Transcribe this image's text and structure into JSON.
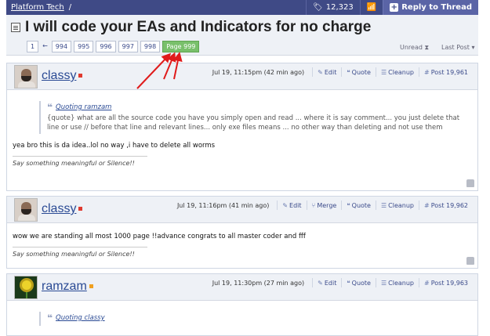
{
  "topbar": {
    "breadcrumb_forum": "Platform Tech",
    "breadcrumb_sep": "/",
    "views_count": "12,323",
    "reply_label": "Reply to Thread"
  },
  "thread": {
    "title": "I will code your EAs and Indicators for no charge",
    "pages": [
      "1",
      "994",
      "995",
      "996",
      "997",
      "998"
    ],
    "prev_arrow": "←",
    "current_page": "Page 999",
    "unread_label": "Unread",
    "lastpost_label": "Last Post"
  },
  "actions": {
    "edit": "Edit",
    "quote": "Quote",
    "cleanup": "Cleanup",
    "merge": "Merge"
  },
  "posts": [
    {
      "username": "classy",
      "date": "Jul 19, 11:15pm (42 min ago)",
      "post_no": "Post 19,961",
      "quote_author": "Quoting ramzam",
      "quote_text": "{quote} what are all the source code you have you simply open and read ... where it is say comment... you just delete that line or use // before that line and relevant lines... only exe files means ... no other way than deleting and not use them",
      "message": "yea bro this is da idea..lol no way ,i have to delete all worms",
      "signature": "Say something meaningful or Silence!!"
    },
    {
      "username": "classy",
      "date": "Jul 19, 11:16pm (41 min ago)",
      "post_no": "Post 19,962",
      "message": "wow we are standing all most 1000 page !!advance congrats to all master coder and fff",
      "signature": "Say something meaningful or Silence!!"
    },
    {
      "username": "ramzam",
      "date": "Jul 19, 11:30pm (27 min ago)",
      "post_no": "Post 19,963",
      "quote_author": "Quoting classy"
    }
  ],
  "colors": {
    "topbar_bg": "#3f4a86",
    "current_page_bg": "#79c06b",
    "annotation_arrow": "#e01b1b"
  }
}
